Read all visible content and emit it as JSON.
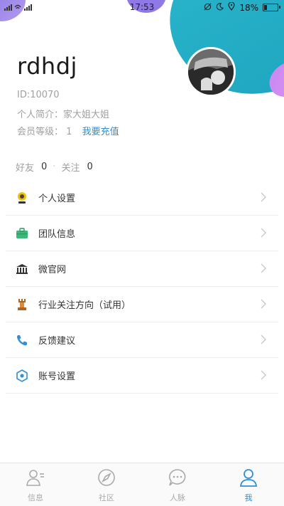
{
  "status_bar": {
    "left": "令 ⁢ 5G ᵢₗₗ",
    "time": "17:53",
    "battery": "18%",
    "battery_level": 0.18
  },
  "profile": {
    "username": "rdhdj",
    "id": "ID:10070",
    "bio": "个人简介：家大姐大姐",
    "level_label": "会员等级：",
    "level_value": "1",
    "recharge_link": "我要充值"
  },
  "stats": {
    "friends_label": "好友",
    "friends_count": "0",
    "follow_label": "关注",
    "follow_count": "0"
  },
  "menu": {
    "items": [
      {
        "label": "个人设置",
        "icon": "person-settings-icon"
      },
      {
        "label": "团队信息",
        "icon": "team-briefcase-icon"
      },
      {
        "label": "微官网",
        "icon": "building-icon"
      },
      {
        "label": "行业关注方向（试用）",
        "icon": "chess-rook-icon"
      },
      {
        "label": "反馈建议",
        "icon": "phone-icon"
      },
      {
        "label": "账号设置",
        "icon": "hexagon-settings-icon"
      }
    ]
  },
  "tabbar": {
    "tabs": [
      {
        "label": "信息",
        "icon": "contacts-icon",
        "active": false
      },
      {
        "label": "社区",
        "icon": "compass-icon",
        "active": false
      },
      {
        "label": "人脉",
        "icon": "chat-bubble-icon",
        "active": false
      },
      {
        "label": "我",
        "icon": "user-icon",
        "active": true
      }
    ]
  },
  "colors": {
    "accent": "#2f8fd8",
    "teal": "#1ea4bf",
    "purple": "#8f79e6"
  }
}
